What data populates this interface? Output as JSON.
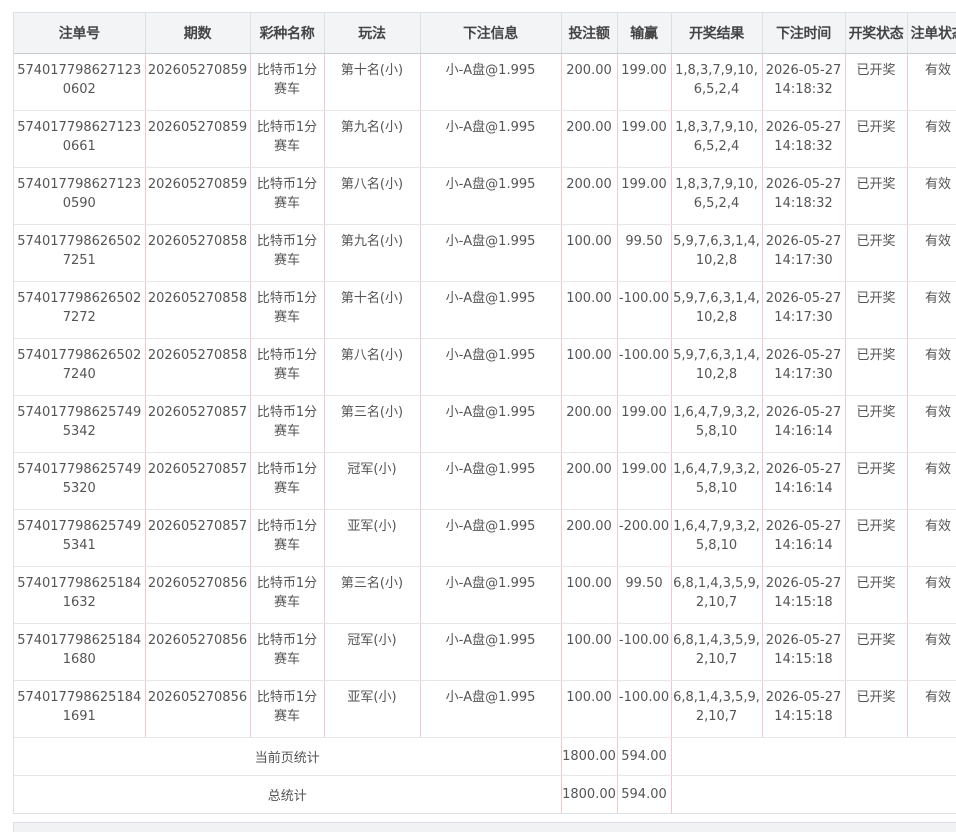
{
  "table": {
    "headers": [
      "注单号",
      "期数",
      "彩种名称",
      "玩法",
      "下注信息",
      "投注额",
      "输赢",
      "开奖结果",
      "下注时间",
      "开奖状态",
      "注单状态"
    ],
    "rows": [
      {
        "order_id": "5740177986271230602",
        "issue": "202605270859",
        "lottery": "比特币1分赛车",
        "play": "第十名(小)",
        "bet_info": "小-A盘@1.995",
        "amount": "200.00",
        "win_loss": "199.00",
        "result": "1,8,3,7,9,10,6,5,2,4",
        "time": "2026-05-27 14:18:32",
        "draw_status": "已开奖",
        "order_status": "有效"
      },
      {
        "order_id": "5740177986271230661",
        "issue": "202605270859",
        "lottery": "比特币1分赛车",
        "play": "第九名(小)",
        "bet_info": "小-A盘@1.995",
        "amount": "200.00",
        "win_loss": "199.00",
        "result": "1,8,3,7,9,10,6,5,2,4",
        "time": "2026-05-27 14:18:32",
        "draw_status": "已开奖",
        "order_status": "有效"
      },
      {
        "order_id": "5740177986271230590",
        "issue": "202605270859",
        "lottery": "比特币1分赛车",
        "play": "第八名(小)",
        "bet_info": "小-A盘@1.995",
        "amount": "200.00",
        "win_loss": "199.00",
        "result": "1,8,3,7,9,10,6,5,2,4",
        "time": "2026-05-27 14:18:32",
        "draw_status": "已开奖",
        "order_status": "有效"
      },
      {
        "order_id": "5740177986265027251",
        "issue": "202605270858",
        "lottery": "比特币1分赛车",
        "play": "第九名(小)",
        "bet_info": "小-A盘@1.995",
        "amount": "100.00",
        "win_loss": "99.50",
        "result": "5,9,7,6,3,1,4,10,2,8",
        "time": "2026-05-27 14:17:30",
        "draw_status": "已开奖",
        "order_status": "有效"
      },
      {
        "order_id": "5740177986265027272",
        "issue": "202605270858",
        "lottery": "比特币1分赛车",
        "play": "第十名(小)",
        "bet_info": "小-A盘@1.995",
        "amount": "100.00",
        "win_loss": "-100.00",
        "result": "5,9,7,6,3,1,4,10,2,8",
        "time": "2026-05-27 14:17:30",
        "draw_status": "已开奖",
        "order_status": "有效"
      },
      {
        "order_id": "5740177986265027240",
        "issue": "202605270858",
        "lottery": "比特币1分赛车",
        "play": "第八名(小)",
        "bet_info": "小-A盘@1.995",
        "amount": "100.00",
        "win_loss": "-100.00",
        "result": "5,9,7,6,3,1,4,10,2,8",
        "time": "2026-05-27 14:17:30",
        "draw_status": "已开奖",
        "order_status": "有效"
      },
      {
        "order_id": "5740177986257495342",
        "issue": "202605270857",
        "lottery": "比特币1分赛车",
        "play": "第三名(小)",
        "bet_info": "小-A盘@1.995",
        "amount": "200.00",
        "win_loss": "199.00",
        "result": "1,6,4,7,9,3,2,5,8,10",
        "time": "2026-05-27 14:16:14",
        "draw_status": "已开奖",
        "order_status": "有效"
      },
      {
        "order_id": "5740177986257495320",
        "issue": "202605270857",
        "lottery": "比特币1分赛车",
        "play": "冠军(小)",
        "bet_info": "小-A盘@1.995",
        "amount": "200.00",
        "win_loss": "199.00",
        "result": "1,6,4,7,9,3,2,5,8,10",
        "time": "2026-05-27 14:16:14",
        "draw_status": "已开奖",
        "order_status": "有效"
      },
      {
        "order_id": "5740177986257495341",
        "issue": "202605270857",
        "lottery": "比特币1分赛车",
        "play": "亚军(小)",
        "bet_info": "小-A盘@1.995",
        "amount": "200.00",
        "win_loss": "-200.00",
        "result": "1,6,4,7,9,3,2,5,8,10",
        "time": "2026-05-27 14:16:14",
        "draw_status": "已开奖",
        "order_status": "有效"
      },
      {
        "order_id": "5740177986251841632",
        "issue": "202605270856",
        "lottery": "比特币1分赛车",
        "play": "第三名(小)",
        "bet_info": "小-A盘@1.995",
        "amount": "100.00",
        "win_loss": "99.50",
        "result": "6,8,1,4,3,5,9,2,10,7",
        "time": "2026-05-27 14:15:18",
        "draw_status": "已开奖",
        "order_status": "有效"
      },
      {
        "order_id": "5740177986251841680",
        "issue": "202605270856",
        "lottery": "比特币1分赛车",
        "play": "冠军(小)",
        "bet_info": "小-A盘@1.995",
        "amount": "100.00",
        "win_loss": "-100.00",
        "result": "6,8,1,4,3,5,9,2,10,7",
        "time": "2026-05-27 14:15:18",
        "draw_status": "已开奖",
        "order_status": "有效"
      },
      {
        "order_id": "5740177986251841691",
        "issue": "202605270856",
        "lottery": "比特币1分赛车",
        "play": "亚军(小)",
        "bet_info": "小-A盘@1.995",
        "amount": "100.00",
        "win_loss": "-100.00",
        "result": "6,8,1,4,3,5,9,2,10,7",
        "time": "2026-05-27 14:15:18",
        "draw_status": "已开奖",
        "order_status": "有效"
      }
    ]
  },
  "summary": {
    "page": {
      "label": "当前页统计",
      "amount": "1800.00",
      "win_loss": "594.00"
    },
    "total": {
      "label": "总统计",
      "amount": "1800.00",
      "win_loss": "594.00"
    }
  }
}
